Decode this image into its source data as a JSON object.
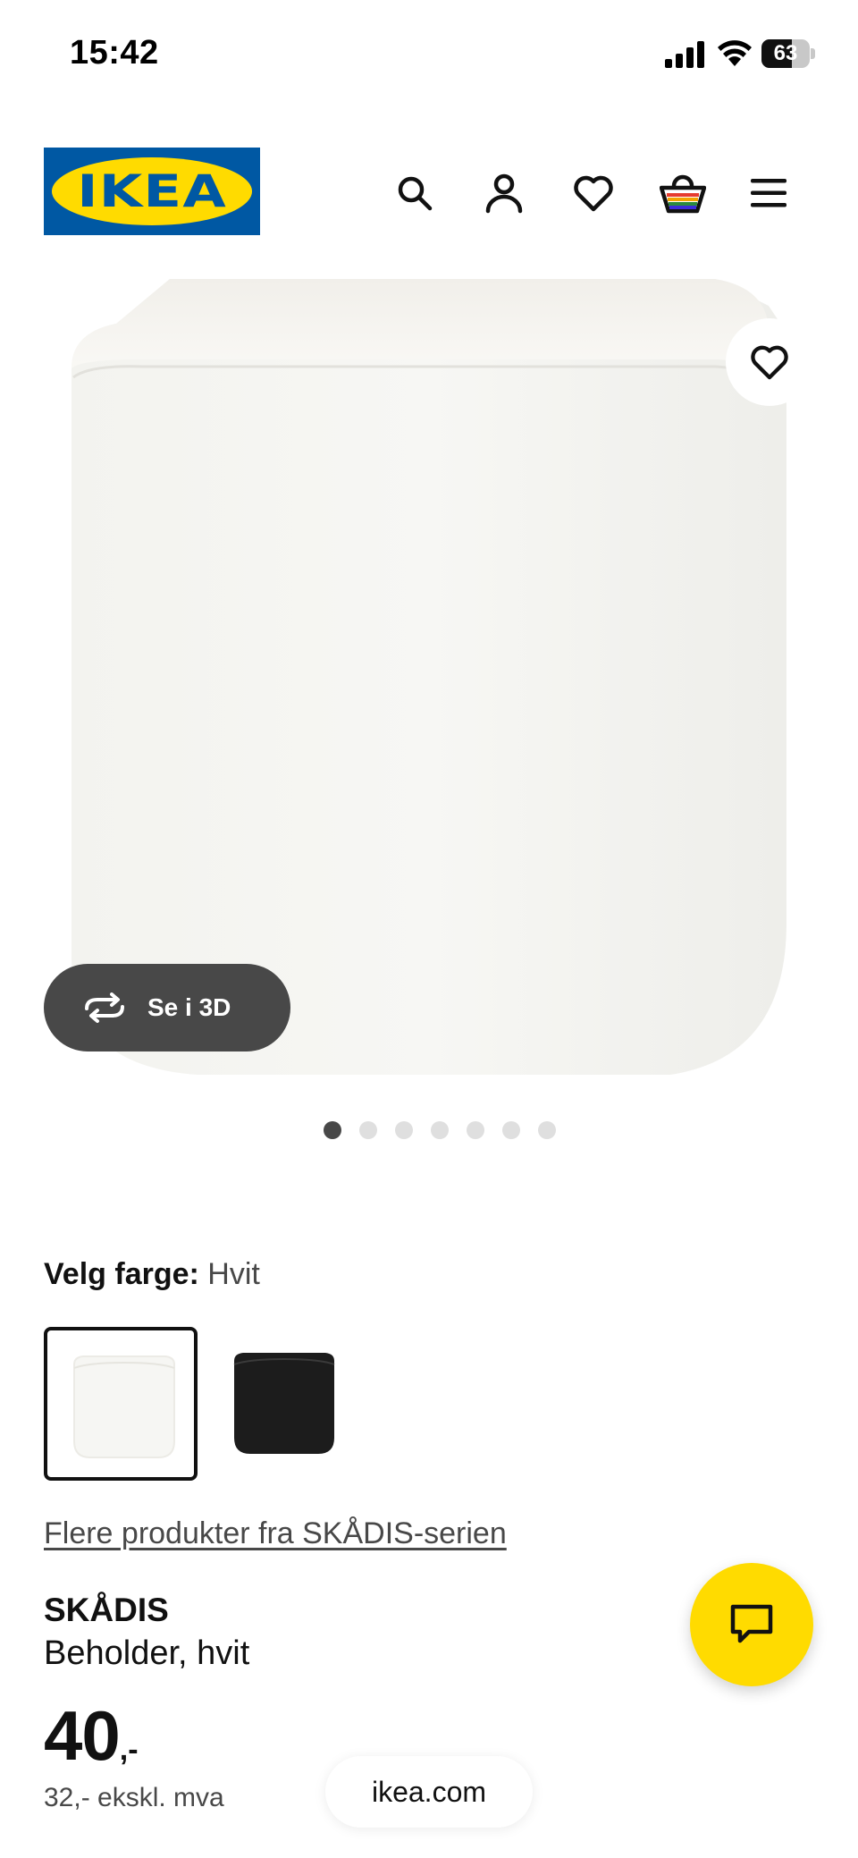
{
  "status_bar": {
    "time": "15:42",
    "battery": "63",
    "battery_level_percent": 63
  },
  "header": {
    "logo_text": "IKEA",
    "brand_colors": {
      "blue": "#0058a3",
      "yellow": "#ffdb00"
    },
    "icons": [
      "search-icon",
      "account-icon",
      "wishlist-heart-icon",
      "shopping-bag-icon",
      "menu-icon"
    ]
  },
  "gallery": {
    "view_3d_label": "Se i 3D",
    "image_count": 7,
    "active_index": 0
  },
  "color_selector": {
    "label": "Velg farge:",
    "value": "Hvit",
    "options": [
      {
        "name": "Hvit",
        "color": "#f6f6f3",
        "selected": true
      },
      {
        "name": "Svart",
        "color": "#1c1c1c",
        "selected": false
      }
    ]
  },
  "series_link": "Flere produkter fra SKÅDIS-serien",
  "product": {
    "name": "SKÅDIS",
    "description": "Beholder, hvit",
    "price_main": "40",
    "price_suffix": ",-",
    "price_ex_vat": "32,- ekskl. mva"
  },
  "browser": {
    "url": "ikea.com"
  }
}
